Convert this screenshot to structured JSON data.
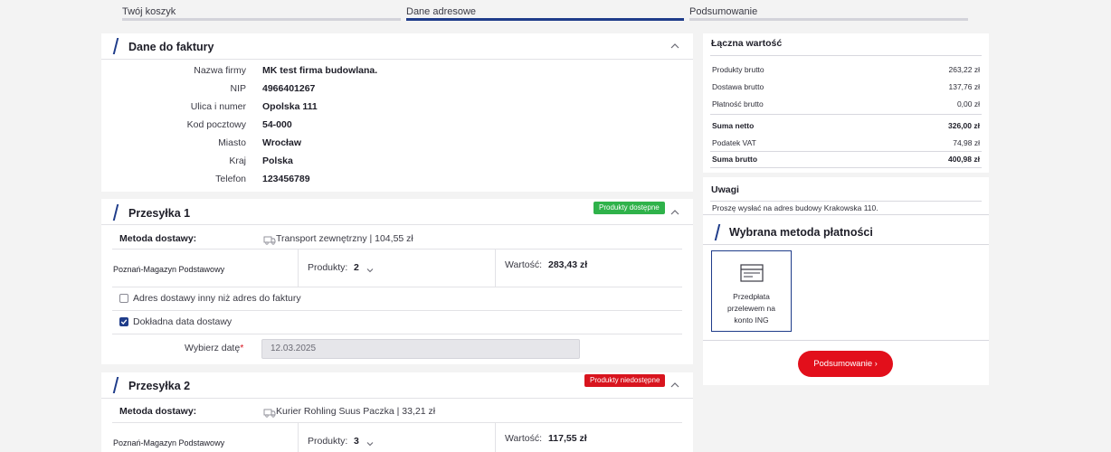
{
  "steps": [
    {
      "label": "Twój koszyk",
      "active": false
    },
    {
      "label": "Dane adresowe",
      "active": true
    },
    {
      "label": "Podsumowanie",
      "active": false
    }
  ],
  "invoice": {
    "title": "Dane do faktury",
    "fields": [
      {
        "label": "Nazwa firmy",
        "value": "MK test firma budowlana."
      },
      {
        "label": "NIP",
        "value": "4966401267"
      },
      {
        "label": "Ulica i numer",
        "value": "Opolska 111"
      },
      {
        "label": "Kod pocztowy",
        "value": "54-000"
      },
      {
        "label": "Miasto",
        "value": "Wrocław"
      },
      {
        "label": "Kraj",
        "value": "Polska"
      },
      {
        "label": "Telefon",
        "value": "123456789"
      }
    ]
  },
  "shipment1": {
    "title": "Przesyłka 1",
    "badge": "Produkty dostępne",
    "method_label": "Metoda dostawy:",
    "method_value": "Transport zewnętrzny | 104,55 zł",
    "warehouse": "Poznań-Magazyn Podstawowy",
    "products_label": "Produkty:",
    "products_count": "2",
    "value_label": "Wartość:",
    "value": "283,43 zł",
    "checkbox1_label": "Adres dostawy inny niż adres do faktury",
    "checkbox2_label": "Dokładna data dostawy",
    "date_label": "Wybierz datę",
    "date_required": "*",
    "date_value": "12.03.2025"
  },
  "shipment2": {
    "title": "Przesyłka 2",
    "badge": "Produkty niedostępne",
    "method_label": "Metoda dostawy:",
    "method_value": "Kurier Rohling Suus Paczka | 33,21 zł",
    "warehouse": "Poznań-Magazyn Podstawowy",
    "products_label": "Produkty:",
    "products_count": "3",
    "value_label": "Wartość:",
    "value": "117,55 zł"
  },
  "summary": {
    "title": "Łączna wartość",
    "rows": [
      {
        "label": "Produkty brutto",
        "value": "263,22 zł"
      },
      {
        "label": "Dostawa brutto",
        "value": "137,76 zł"
      },
      {
        "label": "Płatność brutto",
        "value": "0,00 zł"
      },
      {
        "label": "Suma netto",
        "value": "326,00 zł"
      },
      {
        "label": "Podatek VAT",
        "value": "74,98 zł"
      },
      {
        "label": "Suma brutto",
        "value": "400,98 zł"
      }
    ]
  },
  "notes": {
    "title": "Uwagi",
    "text": "Proszę wysłać na adres budowy Krakowska 110."
  },
  "payment": {
    "title": "Wybrana metoda płatności",
    "option_line1": "Przedpłata",
    "option_line2": "przelewem na",
    "option_line3": "konto ING"
  },
  "summary_button": "Podsumowanie",
  "colors": {
    "accent": "#1f3c8a",
    "cta": "#e20f1b",
    "available": "#2fb24a",
    "unavailable": "#d8141e"
  }
}
